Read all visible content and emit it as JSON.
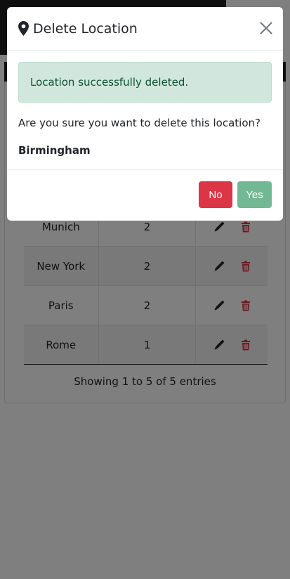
{
  "modal": {
    "title": "Delete Location",
    "alert_text": "Location successfully deleted.",
    "question": "Are you sure you want to delete this location?",
    "location_name": "Birmingham",
    "no_label": "No",
    "yes_label": "Yes"
  },
  "table": {
    "rows": [
      {
        "name": "Munich",
        "count": "2"
      },
      {
        "name": "New York",
        "count": "2"
      },
      {
        "name": "Paris",
        "count": "2"
      },
      {
        "name": "Rome",
        "count": "1"
      }
    ]
  },
  "footer": {
    "info": "Showing 1 to 5 of 5 entries"
  },
  "colors": {
    "danger": "#dc3545",
    "success": "#73b895",
    "alert_bg": "#d1e7dd",
    "alert_text": "#0f5132"
  }
}
